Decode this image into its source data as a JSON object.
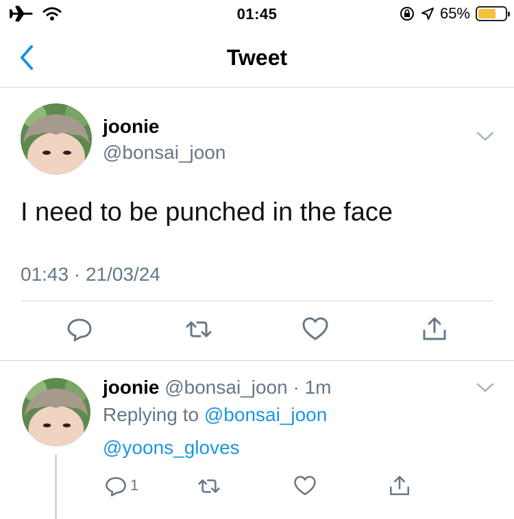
{
  "status_bar": {
    "time": "01:45",
    "battery_percent": "65%",
    "battery_level": 0.65,
    "icons": [
      "airplane-icon",
      "wifi-icon",
      "orientation-lock-icon",
      "location-icon",
      "battery-icon"
    ]
  },
  "nav": {
    "title": "Tweet",
    "back_icon": "chevron-left-icon"
  },
  "tweet": {
    "display_name": "joonie",
    "handle": "@bonsai_joon",
    "text": "I need to be punched in the face",
    "timestamp": "01:43 · 21/03/24",
    "actions": [
      "reply-icon",
      "retweet-icon",
      "like-icon",
      "share-icon"
    ]
  },
  "reply": {
    "display_name": "joonie",
    "handle": "@bonsai_joon",
    "time": "· 1m",
    "replying_prefix": "Replying to ",
    "replying_to": "@bonsai_joon",
    "text": "@yoons_gloves",
    "reply_count": "1"
  },
  "colors": {
    "accent": "#1b95e0",
    "secondary_text": "#657786",
    "divider": "#d0d5d9",
    "battery": "#f4c23b"
  }
}
